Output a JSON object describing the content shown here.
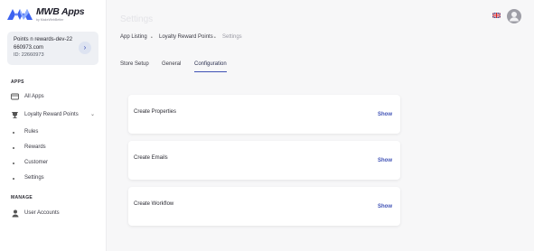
{
  "brand": {
    "name": "MWB Apps",
    "subtitle": "by MakeWebBetter"
  },
  "store": {
    "name": "Points n rewards-dev-22 660973.com",
    "id": "ID: 22660973"
  },
  "sidebar": {
    "apps_heading": "APPS",
    "manage_heading": "MANAGE",
    "all_apps": {
      "label": "All Apps",
      "icon": "card-icon"
    },
    "loyalty": {
      "label": "Loyalty Reward Points",
      "icon": "trophy-icon"
    },
    "sub_items": [
      {
        "label": "Rules"
      },
      {
        "label": "Rewards"
      },
      {
        "label": "Customer"
      },
      {
        "label": "Settings"
      }
    ],
    "user_accounts": {
      "label": "User Accounts",
      "icon": "person-icon"
    }
  },
  "header": {
    "title": "Settings"
  },
  "breadcrumb": {
    "items": [
      "App Listing",
      "Loyalty Reward Points",
      "Settings"
    ],
    "separator": "•"
  },
  "tabs": [
    {
      "label": "Store Setup"
    },
    {
      "label": "General"
    },
    {
      "label": "Configuration"
    }
  ],
  "cards": [
    {
      "title": "Create Properties",
      "action": "Show"
    },
    {
      "title": "Create Emails",
      "action": "Show"
    },
    {
      "title": "Create Workflow",
      "action": "Show"
    }
  ],
  "colors": {
    "accent": "#3f51b5",
    "sidebar_bg": "#ffffff",
    "page_bg": "#f7f7f8"
  }
}
